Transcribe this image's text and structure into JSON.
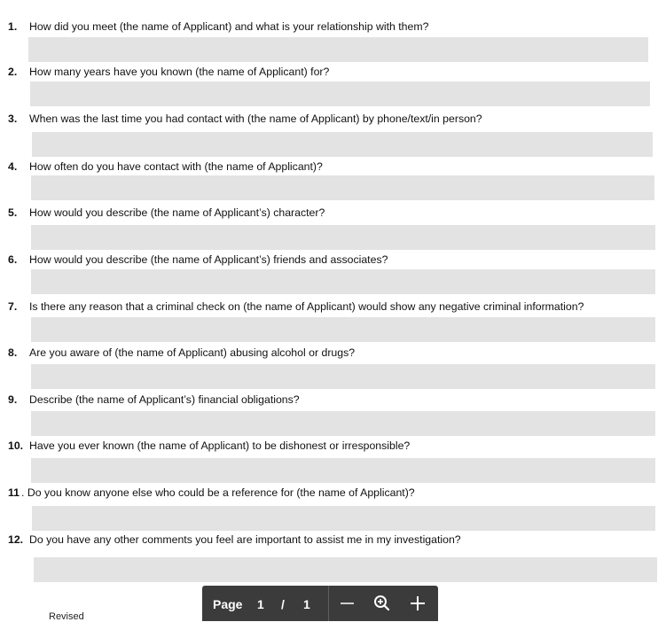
{
  "questions": [
    {
      "num": "1.",
      "text": "How did you meet (the name of Applicant) and what is your relationship with them?",
      "answer": ""
    },
    {
      "num": "2.",
      "text": "How many years have you known (the name of Applicant) for?",
      "answer": ""
    },
    {
      "num": "3.",
      "text": "When was the last time you had contact with (the name of Applicant) by phone/text/in person?",
      "answer": ""
    },
    {
      "num": "4.",
      "text": "How often do you have contact with (the name of Applicant)?",
      "answer": ""
    },
    {
      "num": "5.",
      "text": "How would you describe (the name of Applicant’s) character?",
      "answer": ""
    },
    {
      "num": "6.",
      "text": "How would you describe (the name of Applicant’s) friends and associates?",
      "answer": ""
    },
    {
      "num": "7.",
      "text": "Is there any reason that a criminal check on (the name of Applicant) would show any negative criminal information?",
      "answer": ""
    },
    {
      "num": "8.",
      "text": "Are you aware of (the name of Applicant) abusing alcohol or drugs?",
      "answer": ""
    },
    {
      "num": "9.",
      "text": "Describe (the name of Applicant’s) financial obligations?",
      "answer": ""
    },
    {
      "num": "10.",
      "text": "Have you ever known (the name of Applicant) to be dishonest or irresponsible?",
      "answer": ""
    },
    {
      "num": "11",
      "text": ". Do you know anyone else who could be a reference for (the name of Applicant)?",
      "answer": ""
    },
    {
      "num": "12.",
      "text": "Do you have any other comments you feel are important to assist me in my investigation?",
      "answer": ""
    }
  ],
  "footer": {
    "text": "Revised"
  },
  "toolbar": {
    "page_label": "Page",
    "current_page": "1",
    "separator": "/",
    "total_pages": "1",
    "zoom_out_icon": "minus-icon",
    "zoom_icon": "magnifier-plus-icon",
    "zoom_in_icon": "plus-icon"
  }
}
